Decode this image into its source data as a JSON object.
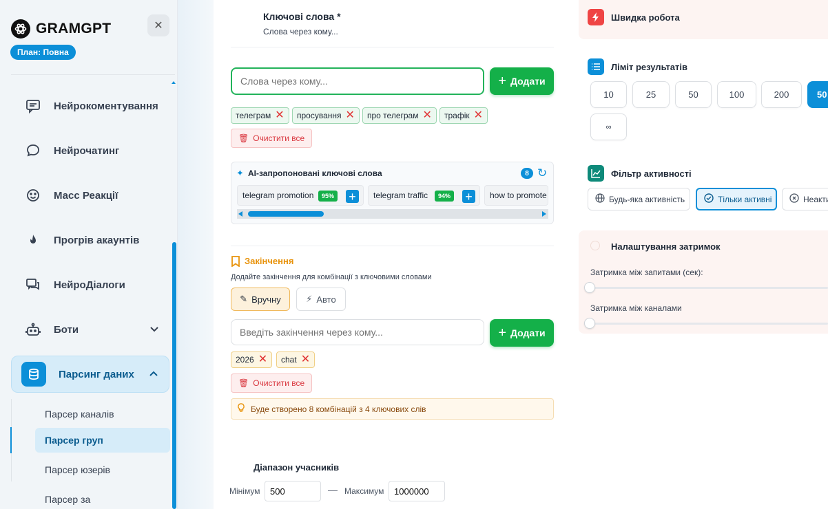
{
  "sidebar": {
    "logo_text": "GRAMGPT",
    "plan_badge": "План: Повна",
    "nav": [
      {
        "label": "Нейрокоментування",
        "icon": "comment-lines-icon"
      },
      {
        "label": "Нейрочатинг",
        "icon": "chat-bubble-icon"
      },
      {
        "label": "Масс Реакції",
        "icon": "smiley-icon"
      },
      {
        "label": "Прогрів акаунтів",
        "icon": "flame-icon"
      },
      {
        "label": "НейроДіалоги",
        "icon": "dialogs-icon"
      },
      {
        "label": "Боти",
        "icon": "robot-icon"
      },
      {
        "label": "Парсинг даних",
        "icon": "database-icon"
      }
    ],
    "sub_items": [
      "Парсер каналів",
      "Парсер груп",
      "Парсер юзерів",
      "Парсер за повідомленнями"
    ],
    "accent": "#0c8fd8"
  },
  "keywords": {
    "title": "Ключові слова *",
    "subtitle": "Слова через кому...",
    "placeholder": "Слова через кому...",
    "add_label": "Додати",
    "tags": [
      "телеграм",
      "просування",
      "про телеграм",
      "трафік"
    ],
    "clear_label": "Очистити все"
  },
  "ai": {
    "title": "AI-запропоновані ключові слова",
    "count": "8",
    "suggestions": [
      {
        "text": "telegram promotion",
        "pct": "95%"
      },
      {
        "text": "telegram traffic",
        "pct": "94%"
      },
      {
        "text": "how to promote i",
        "pct": ""
      }
    ]
  },
  "endings": {
    "title": "Закінчення",
    "subtitle": "Додайте закінчення для комбінації з ключовими словами",
    "mode_manual": "Вручну",
    "mode_auto": "Авто",
    "placeholder": "Введіть закінчення через кому...",
    "add_label": "Додати",
    "tags": [
      "2026",
      "chat"
    ],
    "clear_label": "Очистити все",
    "info": "Буде створено 8 комбінацій з 4 ключових слів"
  },
  "range": {
    "title": "Діапазон учасників",
    "min_label": "Мінімум",
    "min_value": "500",
    "max_label": "Максимум",
    "max_value": "1000000"
  },
  "right": {
    "speed_title": "Швидка робота",
    "limit_title": "Ліміт результатів",
    "limits": [
      "10",
      "25",
      "50",
      "100",
      "200",
      "50",
      "∞"
    ],
    "activity_title": "Фільтр активності",
    "activity_options": [
      "Будь-яка активність",
      "Тільки активні",
      "Неакти"
    ],
    "delay_title": "Налаштування затримок",
    "delay_request_label": "Затримка між запитами (сек):",
    "delay_channel_label": "Затримка між каналами"
  }
}
